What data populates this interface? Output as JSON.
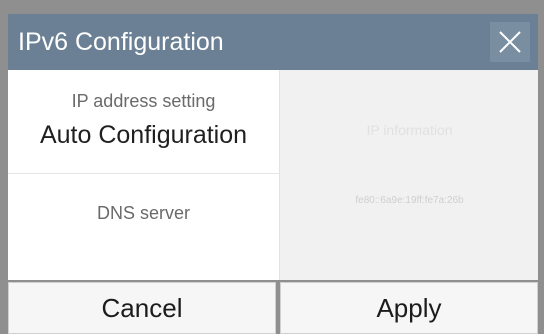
{
  "dialog": {
    "title": "IPv6 Configuration",
    "close_icon": "close-icon"
  },
  "ip_setting": {
    "label": "IP address setting",
    "value": "Auto Configuration"
  },
  "dns": {
    "label": "DNS server"
  },
  "ip_panel": {
    "heading": "IP information",
    "address": "fe80::6a9e:19ff:fe7a:26b"
  },
  "buttons": {
    "cancel_label": "Cancel",
    "apply_label": "Apply"
  },
  "colors": {
    "titlebar": "#6b8094",
    "background": "#8f8f8f",
    "panel": "#f1f1f1"
  }
}
